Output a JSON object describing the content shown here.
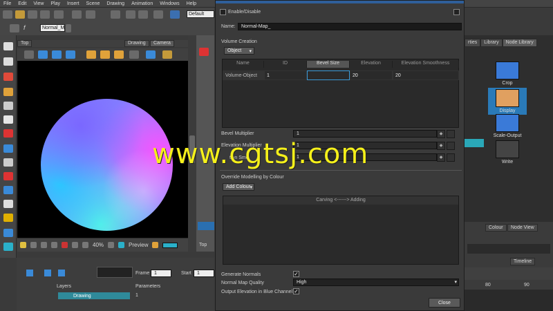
{
  "menubar": [
    "File",
    "Edit",
    "View",
    "Play",
    "Insert",
    "Scene",
    "Drawing",
    "Animation",
    "Windows",
    "Help"
  ],
  "toolbar": {
    "combo_left": "Normal_M",
    "combo_right": "Default",
    "layer_icon_a": "f",
    "layer_icon_b": "f"
  },
  "viewport": {
    "tab_top": "Top",
    "tab_drawing": "Drawing",
    "tab_camera": "Camera",
    "zoom": "40%",
    "preview_label": "Preview",
    "bottom_tab": "Top"
  },
  "timeline": {
    "frame_label": "Frame",
    "frame_value": "1",
    "start_label": "Start",
    "start_value": "1",
    "layers_label": "Layers",
    "parameters_label": "Parameters",
    "row_name": "Drawing",
    "row_value": "1"
  },
  "rightpanel": {
    "tabs": [
      "rties",
      "Library",
      "Node Library"
    ],
    "nodes": [
      {
        "label": "Crop"
      },
      {
        "label": "Display"
      },
      {
        "label": "Scale-Output"
      },
      {
        "label": "Write"
      }
    ],
    "bottom_tabs": [
      "Colour",
      "Node View"
    ],
    "timeline_tab": "Timeline",
    "ruler": [
      "80",
      "90"
    ]
  },
  "dialog": {
    "enable_label": "Enable/Disable",
    "name_label": "Name:",
    "name_value": "Normal-Map_",
    "volume_creation": "Volume Creation",
    "object_button": "Object",
    "table": {
      "headers": [
        "Name",
        "ID",
        "Bevel Size",
        "Elevation",
        "Elevation Smoothness"
      ],
      "row": {
        "name": "Volume-Object",
        "id": "1",
        "bevel": "",
        "elevation": "20",
        "smoothness": "20"
      }
    },
    "bevel_multiplier_label": "Bevel Multiplier",
    "bevel_multiplier_value": "1",
    "elevation_multiplier_label": "Elevation Multiplier",
    "elevation_multiplier_value": "1",
    "elevation_smoothing_label": "tion Smo",
    "elevation_smoothing_value": "1",
    "override_label": "Override Modelling by Colour",
    "add_colour_button": "Add Colour",
    "carving_header": "Carving <------> Adding",
    "generate_normals_label": "Generate Normals",
    "normal_map_quality_label": "Normal Map Quality",
    "normal_map_quality_value": "High",
    "output_elevation_label": "Output Elevation in Blue Channel",
    "close_button": "Close"
  },
  "watermark": "www.cgtsj.com"
}
